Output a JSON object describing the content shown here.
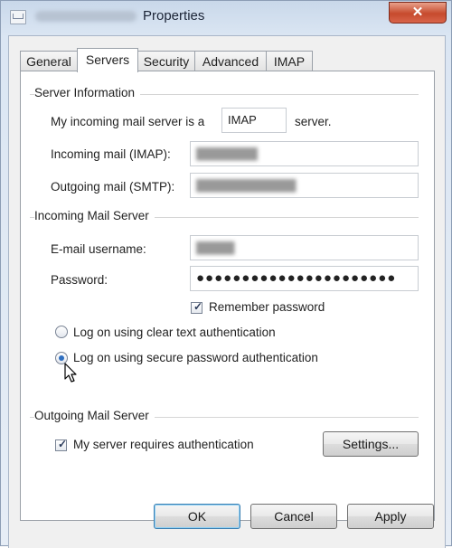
{
  "window": {
    "title": "Properties",
    "close_glyph": "✕"
  },
  "tabs": [
    {
      "label": "General"
    },
    {
      "label": "Servers"
    },
    {
      "label": "Security"
    },
    {
      "label": "Advanced"
    },
    {
      "label": "IMAP"
    }
  ],
  "server_info": {
    "group_label": "Server Information",
    "incoming_type_prefix": "My incoming mail server is a",
    "incoming_type_value": "IMAP",
    "incoming_type_suffix": "server.",
    "incoming_label": "Incoming mail (IMAP):",
    "outgoing_label": "Outgoing mail (SMTP):"
  },
  "incoming_server": {
    "group_label": "Incoming Mail Server",
    "username_label": "E-mail username:",
    "password_label": "Password:",
    "password_mask": "●●●●●●●●●●●●●●●●●●●●●●",
    "remember_label": "Remember password",
    "remember_checked": true,
    "radio_clear_label": "Log on using clear text authentication",
    "radio_secure_label": "Log on using secure password authentication",
    "selected_auth": "secure"
  },
  "outgoing_server": {
    "group_label": "Outgoing Mail Server",
    "requires_auth_label": "My server requires authentication",
    "requires_auth_checked": true,
    "settings_button": "Settings..."
  },
  "buttons": {
    "ok": "OK",
    "cancel": "Cancel",
    "apply": "Apply"
  },
  "icons": {
    "close": "close-icon",
    "checkbox_tick": "✓",
    "cursor": "mouse-pointer-icon"
  }
}
